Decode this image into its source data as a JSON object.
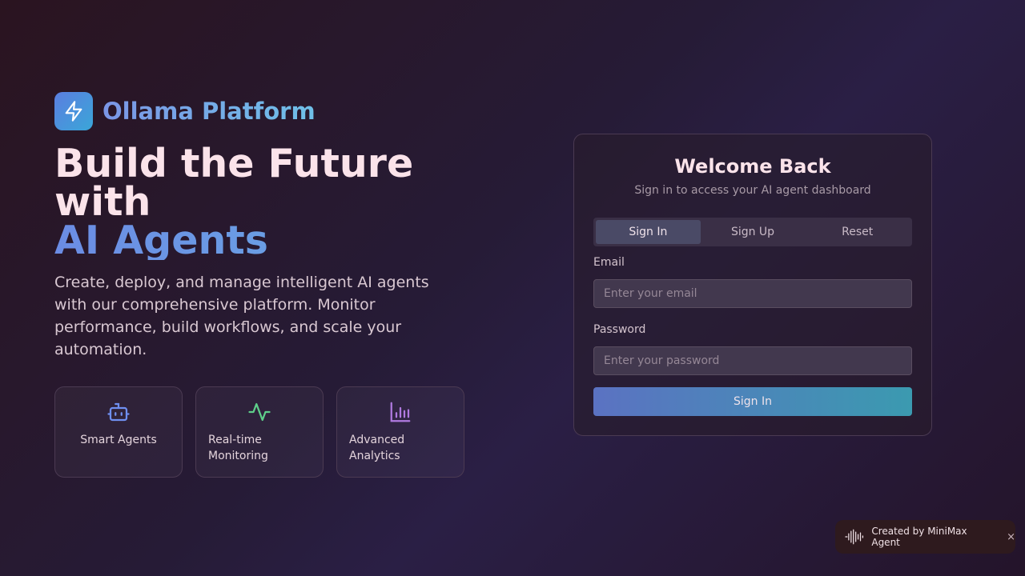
{
  "brand": {
    "name": "Ollama Platform"
  },
  "hero": {
    "line1": "Build the Future",
    "line2": "with",
    "line3": "AI Agents",
    "description": "Create, deploy, and manage intelligent AI agents with our comprehensive platform. Monitor performance, build workflows, and scale your automation."
  },
  "features": [
    {
      "label": "Smart Agents",
      "icon": "robot-icon",
      "color": "#6f8ff0"
    },
    {
      "label": "Real-time Monitoring",
      "icon": "activity-icon",
      "color": "#5ecf8a"
    },
    {
      "label": "Advanced Analytics",
      "icon": "bar-chart-icon",
      "color": "#b07ae0"
    }
  ],
  "auth": {
    "title": "Welcome Back",
    "subtitle": "Sign in to access your AI agent dashboard",
    "tabs": [
      "Sign In",
      "Sign Up",
      "Reset"
    ],
    "active_tab": "Sign In",
    "email_label": "Email",
    "email_placeholder": "Enter your email",
    "password_label": "Password",
    "password_placeholder": "Enter your password",
    "submit_label": "Sign In"
  },
  "badge": {
    "text": "Created by MiniMax Agent",
    "close": "×"
  }
}
